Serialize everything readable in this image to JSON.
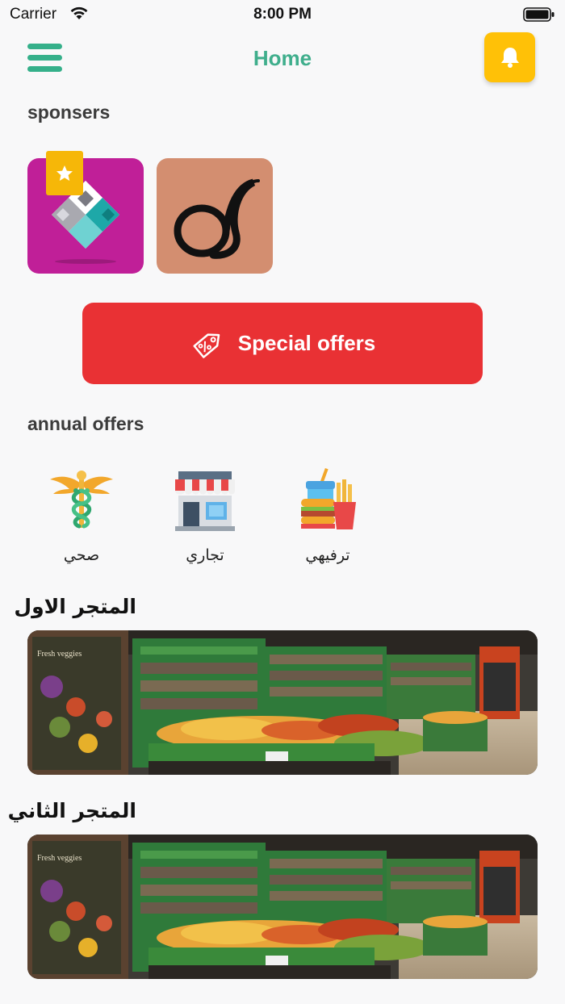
{
  "status_bar": {
    "carrier": "Carrier",
    "time": "8:00 PM"
  },
  "header": {
    "title": "Home",
    "menu_icon": "hamburger-menu-icon",
    "notification_icon": "bell-icon",
    "accent_color": "#3fae8c",
    "bell_bg": "#ffc107"
  },
  "sponsors": {
    "title": "sponsers",
    "items": [
      {
        "logo": "diamond-logo",
        "bg": "#c01f98",
        "featured": true
      },
      {
        "logo": "script-s-logo",
        "bg": "#d38e70",
        "featured": false
      }
    ]
  },
  "special_offers": {
    "label": "Special offers",
    "icon": "price-tag-icon",
    "color": "#e93134"
  },
  "annual_offers": {
    "title": "annual offers",
    "categories": [
      {
        "label": "صحي",
        "icon": "caduceus-icon"
      },
      {
        "label": "تجاري",
        "icon": "storefront-icon"
      },
      {
        "label": "ترفيهي",
        "icon": "fast-food-icon"
      }
    ]
  },
  "stores": [
    {
      "title": "المتجر الاول"
    },
    {
      "title": "المتجر الثاني"
    }
  ]
}
